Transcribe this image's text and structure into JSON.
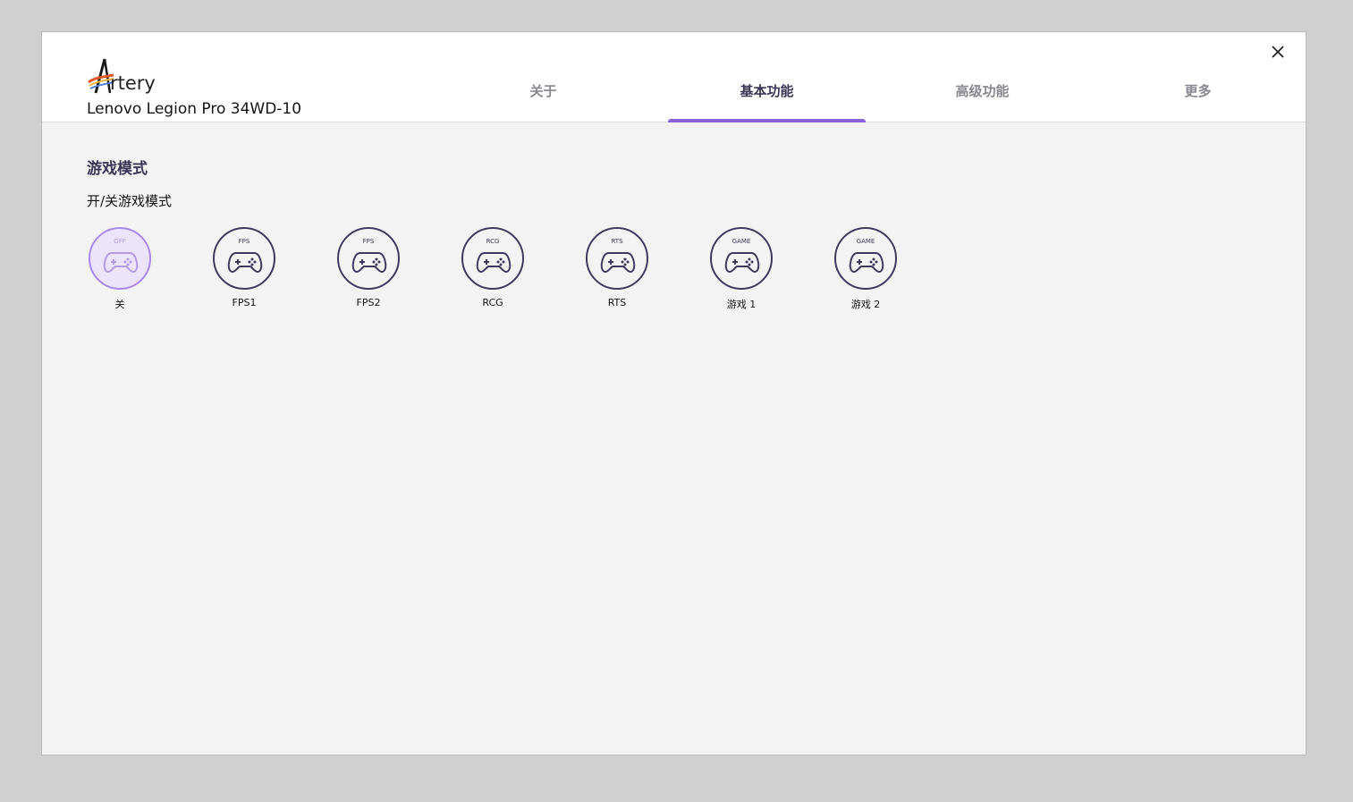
{
  "app": {
    "logo_text": "rtery",
    "model_name": "Lenovo Legion Pro 34WD-10",
    "close_icon": "close-icon"
  },
  "tabs": [
    {
      "label": "关于",
      "active": false
    },
    {
      "label": "基本功能",
      "active": true
    },
    {
      "label": "高级功能",
      "active": false
    },
    {
      "label": "更多",
      "active": false
    }
  ],
  "section": {
    "title": "游戏模式",
    "subtitle": "开/关游戏模式"
  },
  "game_modes": [
    {
      "badge": "OFF",
      "label": "关",
      "selected": true,
      "icon": "gamepad-icon"
    },
    {
      "badge": "FPS",
      "label": "FPS1",
      "selected": false,
      "icon": "gamepad-icon"
    },
    {
      "badge": "FPS",
      "label": "FPS2",
      "selected": false,
      "icon": "gamepad-icon"
    },
    {
      "badge": "RCG",
      "label": "RCG",
      "selected": false,
      "icon": "gamepad-icon"
    },
    {
      "badge": "RTS",
      "label": "RTS",
      "selected": false,
      "icon": "gamepad-icon"
    },
    {
      "badge": "GAME",
      "label": "游戏 1",
      "selected": false,
      "icon": "gamepad-icon"
    },
    {
      "badge": "GAME",
      "label": "游戏 2",
      "selected": false,
      "icon": "gamepad-icon"
    }
  ],
  "colors": {
    "accent": "#8a63d8",
    "selected_fill": "#ece4fb",
    "selected_border": "#a889ec",
    "dark": "#3f3a5c"
  }
}
